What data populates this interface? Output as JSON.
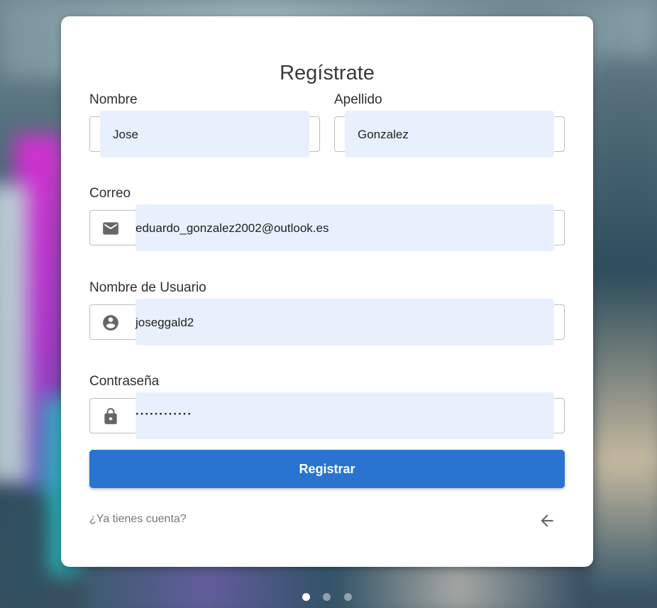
{
  "form": {
    "title": "Regístrate",
    "first_name": {
      "label": "Nombre",
      "value": "Jose"
    },
    "last_name": {
      "label": "Apellido",
      "value": "Gonzalez"
    },
    "email": {
      "label": "Correo",
      "value": "eduardo_gonzalez2002@outlook.es",
      "icon": "mail-icon"
    },
    "username": {
      "label": "Nombre de Usuario",
      "value": "joseggald2",
      "icon": "account-circle-icon"
    },
    "password": {
      "label": "Contraseña",
      "value": "············",
      "icon": "lock-icon"
    },
    "submit_label": "Registrar",
    "login_link": "¿Ya tienes cuenta?",
    "back_icon": "arrow-left-icon"
  },
  "carousel": {
    "dots": 3,
    "active_index": 0
  },
  "colors": {
    "primary": "#2874d0",
    "autofill": "#e8f0fe",
    "icon": "#666666"
  }
}
